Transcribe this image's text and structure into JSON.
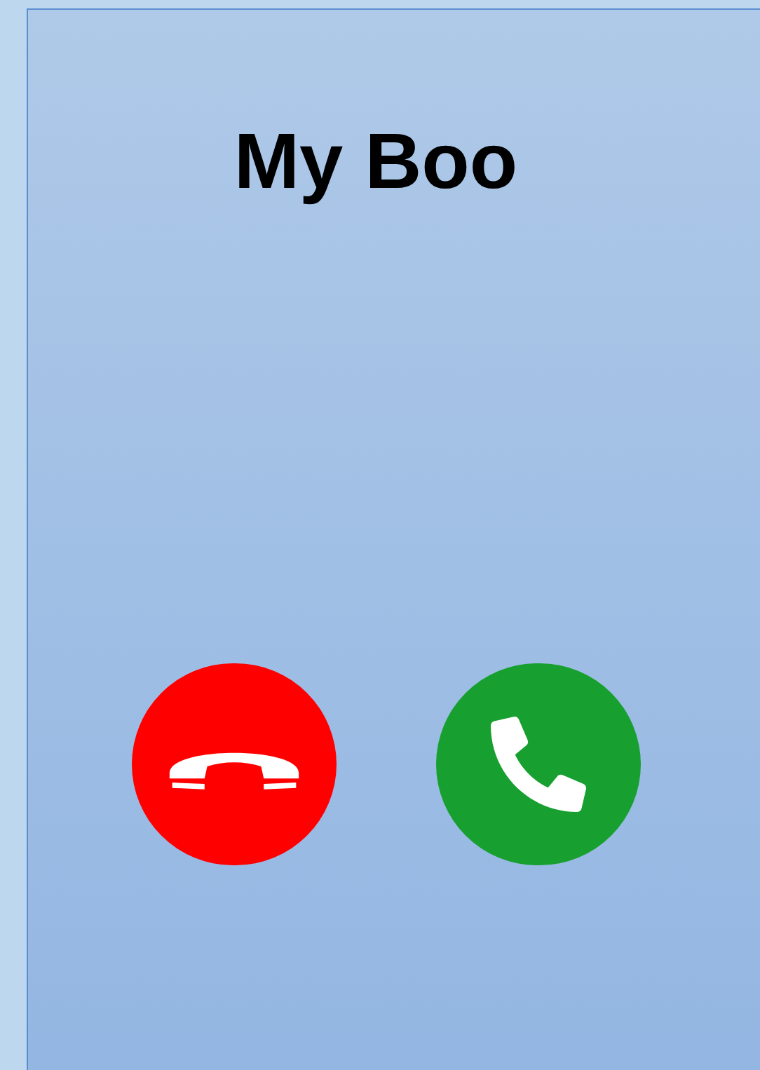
{
  "caller": {
    "name": "My Boo"
  },
  "buttons": [
    {
      "kind": "decline"
    },
    {
      "kind": "accept"
    }
  ]
}
